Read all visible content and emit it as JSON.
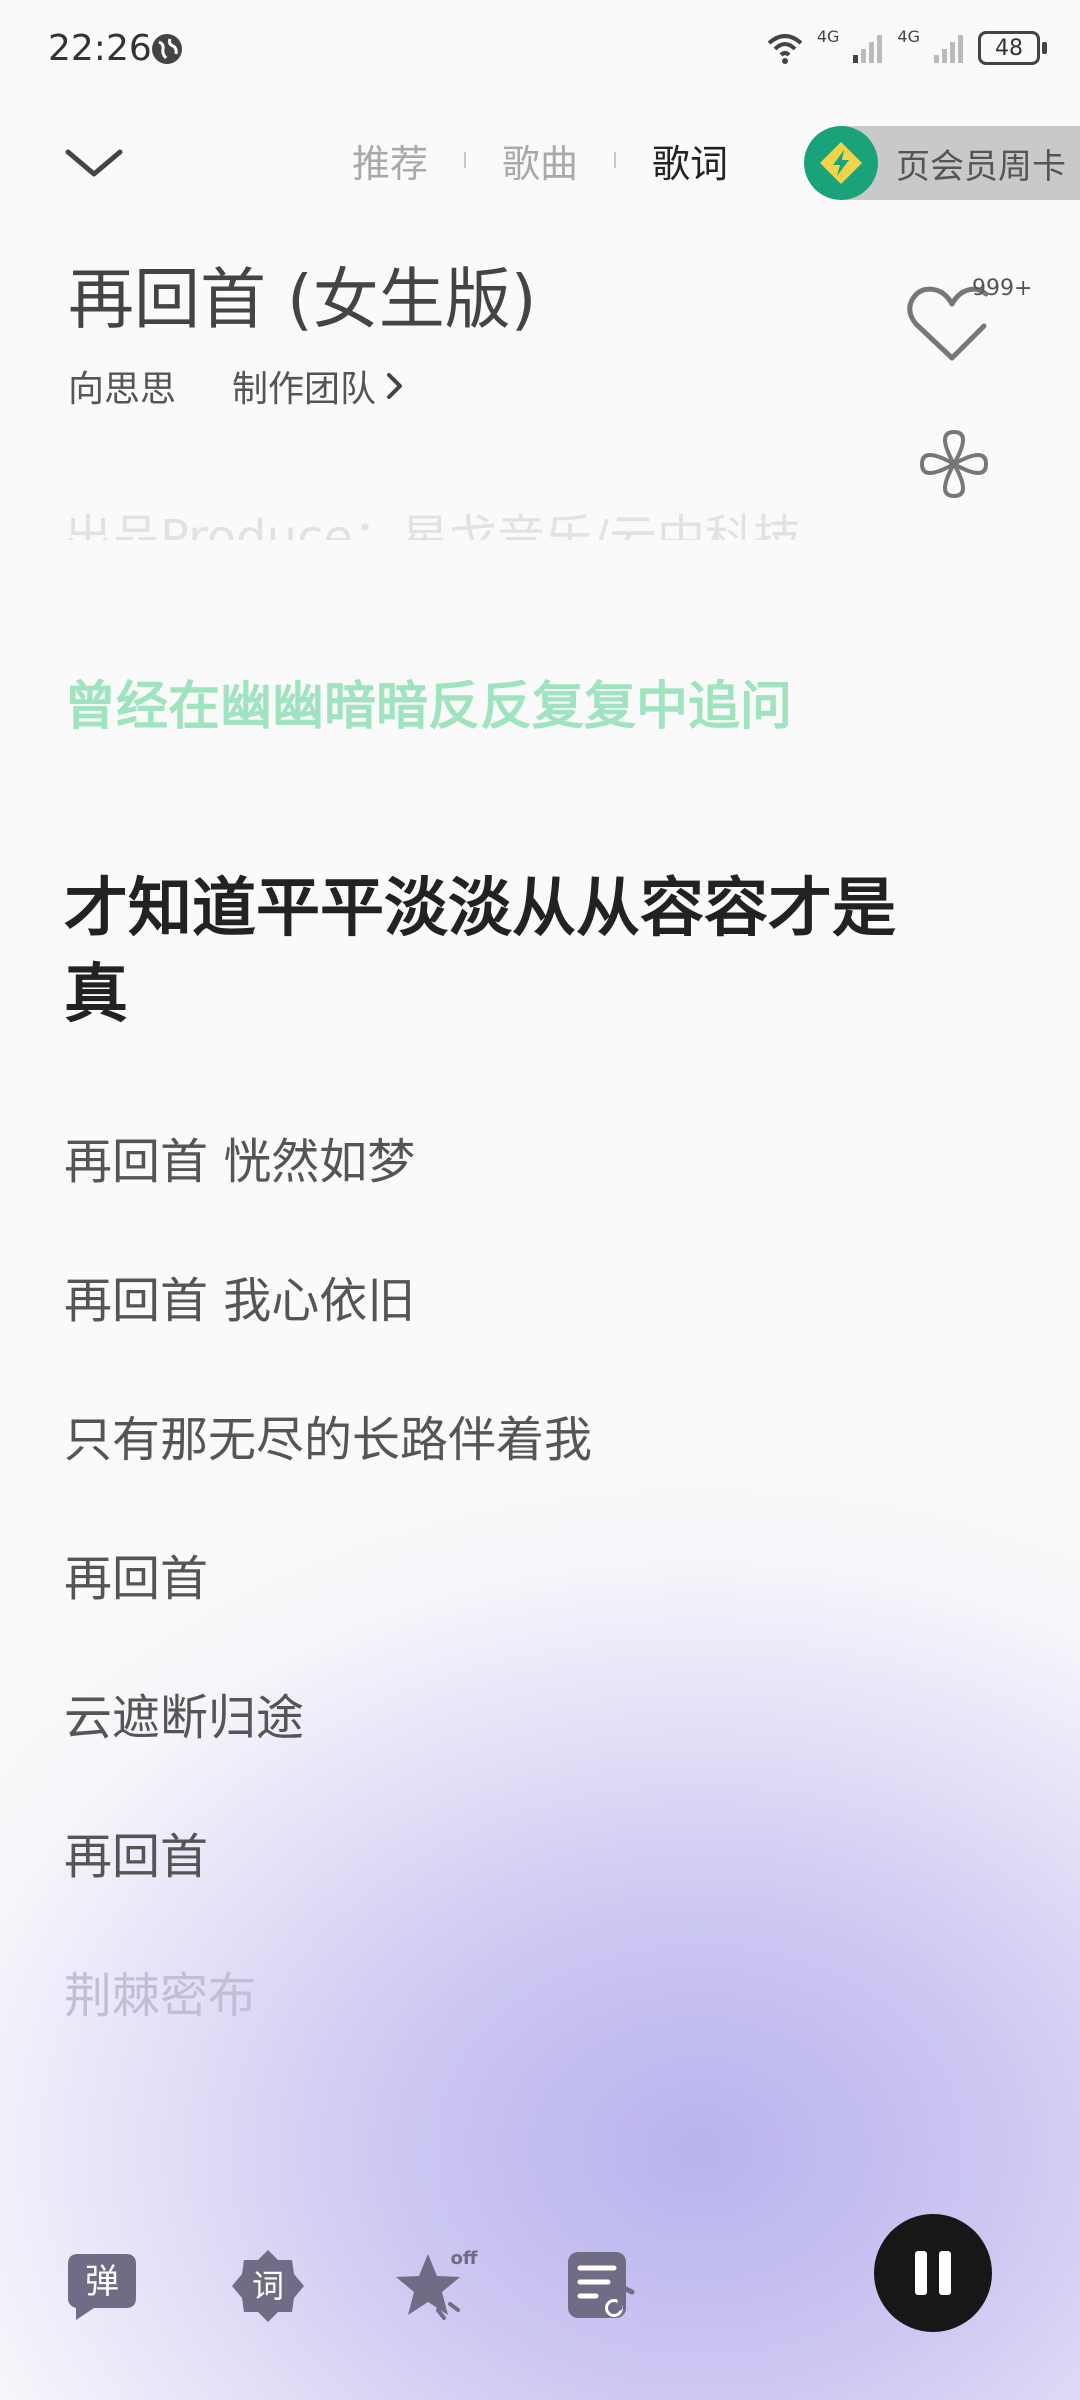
{
  "status_bar": {
    "time": "22:26",
    "network_1": "4G",
    "network_2": "4G",
    "battery": "48"
  },
  "header": {
    "tabs": [
      {
        "label": "推荐",
        "active": false
      },
      {
        "label": "歌曲",
        "active": false
      },
      {
        "label": "歌词",
        "active": true
      }
    ],
    "vip_promo": "页会员周卡"
  },
  "song": {
    "title": "再回首 (女生版)",
    "artist": "向思思",
    "credits_label": "制作团队",
    "like_count": "999+"
  },
  "lyrics": {
    "faded_top": "出品Produce：星戈音乐/云中科技",
    "lines": [
      "曾经在幽幽暗暗反反复复中追问",
      "才知道平平淡淡从从容容才是真",
      "再回首 恍然如梦",
      "再回首 我心依旧",
      "只有那无尽的长路伴着我",
      "再回首",
      "云遮断归途",
      "再回首",
      "荆棘密布"
    ]
  },
  "bottom_bar": {
    "danmaku_label": "弹",
    "lyric_label": "词",
    "star_badge": "off"
  },
  "colors": {
    "accent_green": "#1aa37a",
    "highlight_lyric": "#9fe3bf",
    "bottom_glow": "#b9b3ee",
    "icon_gray": "#6f6d85"
  }
}
